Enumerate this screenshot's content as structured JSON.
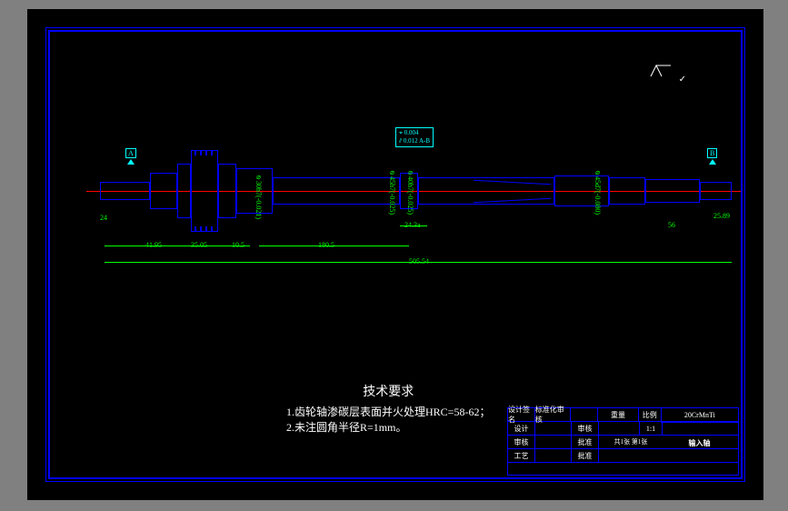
{
  "surface_finish": "✓",
  "datum": {
    "a": "A",
    "b": "B"
  },
  "tolerance_box": {
    "line1": "⌖ 0.004",
    "line2": "⫽ 0.012 A-B"
  },
  "dims": {
    "d24_left": "24",
    "d41_95": "41.95",
    "d35_05": "35.05",
    "d10_5": "10.5",
    "d30h7": "⌀30h7(-0.021)",
    "d45h7": "⌀45h7(-0.025)",
    "d40h7": "⌀40h7(-0.025)",
    "d180_5": "180.5",
    "d24_3a": "24.3a",
    "d505_54": "505.54",
    "d45d7": "⌀45d7(-0.080)",
    "d56_right": "56",
    "d25_right": "25.89"
  },
  "tech": {
    "title": "技术要求",
    "line1": "1.齿轮轴渗碳层表面并火处理HRC=58-62；",
    "line2": "2.未注圆角半径R=1mm。"
  },
  "titleblock": {
    "material": "20CrMnTi",
    "partname": "输入轴",
    "row1": {
      "c1": "设计签名",
      "c2": "标准化审核",
      "c3": "",
      "c4": "重量",
      "c5": "比例"
    },
    "row2": {
      "c1": "设计",
      "c2": "",
      "c3": "审核",
      "c4": "",
      "c5": "1:1"
    },
    "row3": {
      "c1": "审核",
      "c2": "",
      "c3": "批准",
      "c4": "共1张 第1张",
      "c5": ""
    },
    "row4": {
      "c1": "工艺",
      "c2": "",
      "c3": "批准",
      "c4": "",
      "c5": ""
    }
  }
}
